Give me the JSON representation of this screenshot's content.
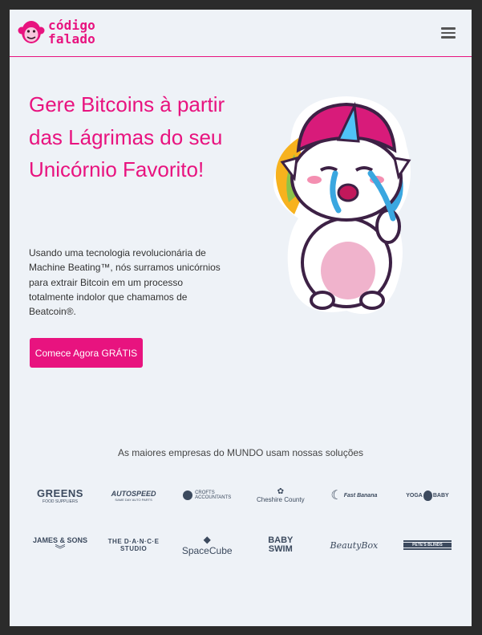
{
  "header": {
    "logo_line1": "código",
    "logo_line2": "falado"
  },
  "hero": {
    "title": "Gere Bitcoins à partir das Lágrimas do seu Unicórnio Favorito!",
    "description": "Usando uma tecnologia revolucionária de Machine Beating™, nós surramos unicórnios para extrair Bitcoin em um processo totalmente indolor que chamamos de Beatcoin®.",
    "cta_label": "Comece Agora GRÁTIS"
  },
  "clients": {
    "title": "As maiores empresas do MUNDO usam nossas soluções",
    "logos": [
      {
        "name": "GREENS",
        "sub": "FOOD SUPPLIERS"
      },
      {
        "name": "AUTOSPEED",
        "sub": "SAME DAY AUTO PARTS"
      },
      {
        "name": "CROFTS",
        "sub": "ACCOUNTANTS"
      },
      {
        "name": "Cheshire County",
        "sub": ""
      },
      {
        "name": "Fast Banana",
        "sub": ""
      },
      {
        "name": "YOGA",
        "sub": "BABY"
      },
      {
        "name": "JAMES & SONS",
        "sub": ""
      },
      {
        "name": "THE D·A·N·C·E STUDIO",
        "sub": ""
      },
      {
        "name": "SpaceCube",
        "sub": ""
      },
      {
        "name": "BABY SWIM",
        "sub": ""
      },
      {
        "name": "BeautyBox",
        "sub": ""
      },
      {
        "name": "PETE'S BLINDS",
        "sub": ""
      }
    ]
  },
  "colors": {
    "brand": "#e8137f",
    "background": "#eef2f7",
    "logo_gray": "#3c4a5e"
  },
  "icons": {
    "menu": "hamburger-icon",
    "brand": "monkey-icon"
  }
}
